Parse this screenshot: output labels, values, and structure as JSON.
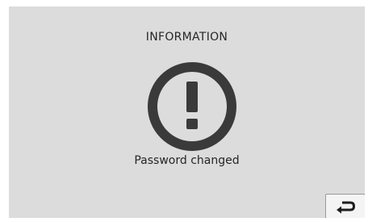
{
  "dialog": {
    "title": "INFORMATION",
    "icon": "exclamation-circle-icon",
    "message": "Password changed"
  },
  "controls": {
    "back_icon": "return-arrow-icon"
  },
  "colors": {
    "background": "#dcdcdc",
    "icon": "#3a3a3a",
    "text": "#262626",
    "button_bg": "#f4f4f4",
    "button_border": "#9a9a9a"
  }
}
